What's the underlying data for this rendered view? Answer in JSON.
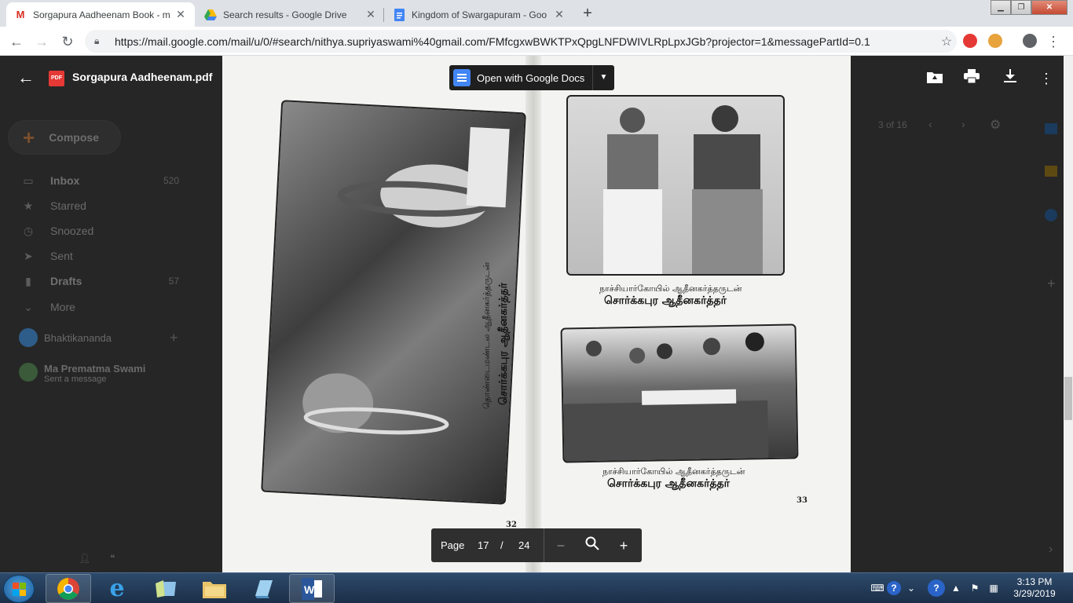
{
  "browser": {
    "tabs": [
      {
        "title": "Sorgapura Aadheenam Book - m",
        "icon": "gmail-icon",
        "active": true
      },
      {
        "title": "Search results - Google Drive",
        "icon": "google-drive-icon",
        "active": false
      },
      {
        "title": "Kingdom of Swargapuram - Goo",
        "icon": "google-docs-icon",
        "active": false
      }
    ],
    "url": "https://mail.google.com/mail/u/0/#search/nithya.supriyaswami%40gmail.com/FMfcgxwBWKTPxQpgLNFDWIVLRpLpxJGb?projector=1&messagePartId=0.1"
  },
  "gmail": {
    "compose_label": "Compose",
    "nav": [
      {
        "label": "Inbox",
        "count": "520",
        "icon": "inbox-icon",
        "bold": true
      },
      {
        "label": "Starred",
        "count": "",
        "icon": "star-icon",
        "bold": false
      },
      {
        "label": "Snoozed",
        "count": "",
        "icon": "clock-icon",
        "bold": false
      },
      {
        "label": "Sent",
        "count": "",
        "icon": "send-icon",
        "bold": false
      },
      {
        "label": "Drafts",
        "count": "57",
        "icon": "draft-icon",
        "bold": true
      },
      {
        "label": "More",
        "count": "",
        "icon": "chevron-down-icon",
        "bold": false
      }
    ],
    "hangouts_user": "Bhaktikananda",
    "contact_name": "Ma Prematma Swami",
    "contact_status": "Sent a message",
    "pagination": "3 of 16"
  },
  "viewer": {
    "file_name": "Sorgapura Aadheenam.pdf",
    "file_badge": "PDF",
    "open_with_label": "Open with Google Docs",
    "pager": {
      "label": "Page",
      "current": "17",
      "separator": "/",
      "total": "24"
    }
  },
  "pdf": {
    "left_caption_small": "தொண்டைமண்டல ஆதீனகர்த்தருடன்",
    "left_caption_large": "சொர்க்கபுர ஆதீனகர்த்தர்",
    "right_top_caption_small": "நாச்சியார்கோயில் ஆதீனகர்த்தருடன்",
    "right_top_caption_large": "சொர்க்கபுர ஆதீனகர்த்தர்",
    "right_bottom_caption_small": "நாச்சியார்கோயில் ஆதீனகர்த்தருடன்",
    "right_bottom_caption_large": "சொர்க்கபுர ஆதீனகர்த்தர்",
    "left_page_number": "32",
    "right_page_number": "33"
  },
  "taskbar": {
    "time": "3:13 PM",
    "date": "3/29/2019"
  }
}
